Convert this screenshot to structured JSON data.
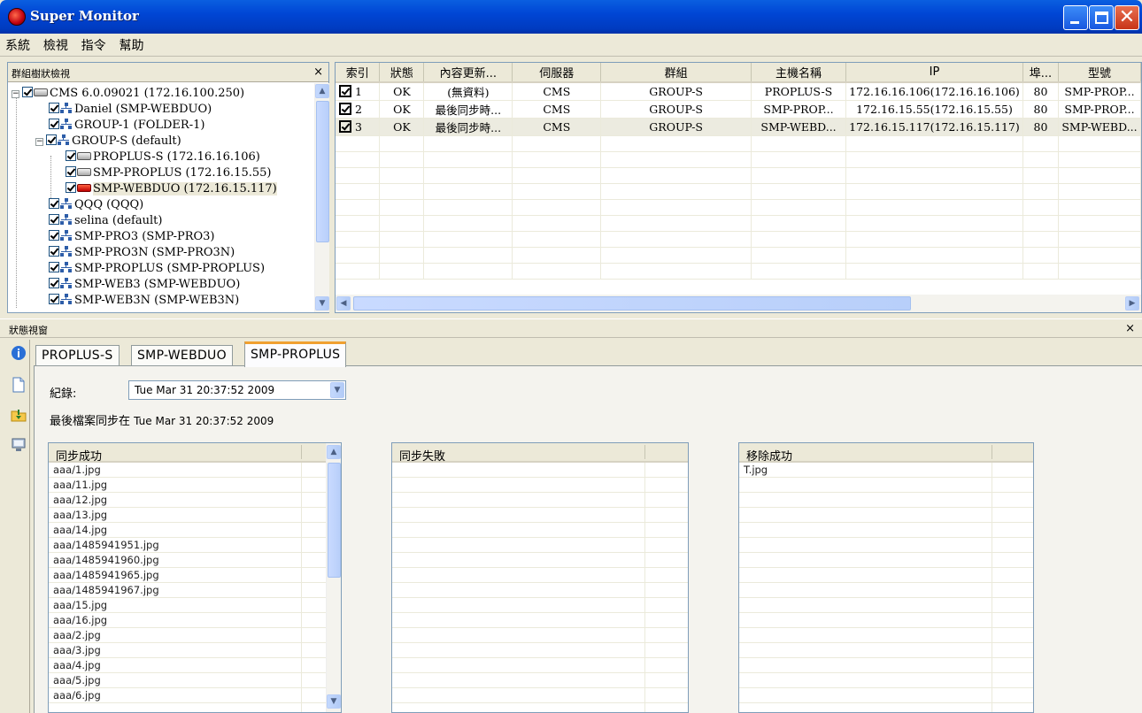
{
  "window": {
    "title": "Super Monitor"
  },
  "menu": [
    "系統",
    "檢視",
    "指令",
    "幫助"
  ],
  "tree": {
    "header": "群組樹狀檢視",
    "nodes": [
      {
        "label": "CMS  6.0.09021  (172.16.100.250)",
        "icon": "computer-icon",
        "level": 0,
        "expander": "-"
      },
      {
        "label": "Daniel  (SMP-WEBDUO)",
        "icon": "network-group-icon",
        "level": 1
      },
      {
        "label": "GROUP-1  (FOLDER-1)",
        "icon": "network-group-icon",
        "level": 1
      },
      {
        "label": "GROUP-S  (default)",
        "icon": "network-group-icon",
        "level": 1,
        "expander": "-"
      },
      {
        "label": "PROPLUS-S  (172.16.16.106)",
        "icon": "device-icon",
        "level": 2
      },
      {
        "label": "SMP-PROPLUS  (172.16.15.55)",
        "icon": "device-icon",
        "level": 2
      },
      {
        "label": "SMP-WEBDUO  (172.16.15.117)",
        "icon": "device-alert-icon",
        "level": 2,
        "selected": true
      },
      {
        "label": "QQQ  (QQQ)",
        "icon": "network-group-icon",
        "level": 1
      },
      {
        "label": "selina  (default)",
        "icon": "network-group-icon",
        "level": 1
      },
      {
        "label": "SMP-PRO3  (SMP-PRO3)",
        "icon": "network-group-icon",
        "level": 1
      },
      {
        "label": "SMP-PRO3N  (SMP-PRO3N)",
        "icon": "network-group-icon",
        "level": 1
      },
      {
        "label": "SMP-PROPLUS  (SMP-PROPLUS)",
        "icon": "network-group-icon",
        "level": 1
      },
      {
        "label": "SMP-WEB3  (SMP-WEBDUO)",
        "icon": "network-group-icon",
        "level": 1
      },
      {
        "label": "SMP-WEB3N  (SMP-WEB3N)",
        "icon": "network-group-icon",
        "level": 1
      }
    ]
  },
  "grid": {
    "columns": [
      "索引",
      "狀態",
      "內容更新...",
      "伺服器",
      "群組",
      "主機名稱",
      "IP",
      "埠...",
      "型號"
    ],
    "rows": [
      [
        "1",
        "OK",
        "(無資料)",
        "CMS",
        "GROUP-S",
        "PROPLUS-S",
        "172.16.16.106(172.16.16.106)",
        "80",
        "SMP-PROP..."
      ],
      [
        "2",
        "OK",
        "最後同步時...",
        "CMS",
        "GROUP-S",
        "SMP-PROP...",
        "172.16.15.55(172.16.15.55)",
        "80",
        "SMP-PROP..."
      ],
      [
        "3",
        "OK",
        "最後同步時...",
        "CMS",
        "GROUP-S",
        "SMP-WEBD...",
        "172.16.15.117(172.16.15.117)",
        "80",
        "SMP-WEBD..."
      ]
    ],
    "selected_row": 2
  },
  "status": {
    "header": "狀態視窗",
    "tabs": [
      "PROPLUS-S",
      "SMP-WEBDUO",
      "SMP-PROPLUS"
    ],
    "active_tab": 2,
    "record_label": "紀錄:",
    "record_value": "Tue Mar 31 20:37:52 2009",
    "last_sync_label": "最後檔案同步在",
    "last_sync_time": "Tue Mar 31 20:37:52 2009",
    "lists": [
      {
        "title": "同步成功",
        "items": [
          "aaa/1.jpg",
          "aaa/11.jpg",
          "aaa/12.jpg",
          "aaa/13.jpg",
          "aaa/14.jpg",
          "aaa/1485941951.jpg",
          "aaa/1485941960.jpg",
          "aaa/1485941965.jpg",
          "aaa/1485941967.jpg",
          "aaa/15.jpg",
          "aaa/16.jpg",
          "aaa/2.jpg",
          "aaa/3.jpg",
          "aaa/4.jpg",
          "aaa/5.jpg",
          "aaa/6.jpg"
        ]
      },
      {
        "title": "同步失敗",
        "items": []
      },
      {
        "title": "移除成功",
        "items": [
          "T.jpg"
        ]
      }
    ]
  },
  "colors": {
    "titlebar": "#0046d5",
    "close": "#c83418",
    "tab_highlight": "#f0a030"
  }
}
